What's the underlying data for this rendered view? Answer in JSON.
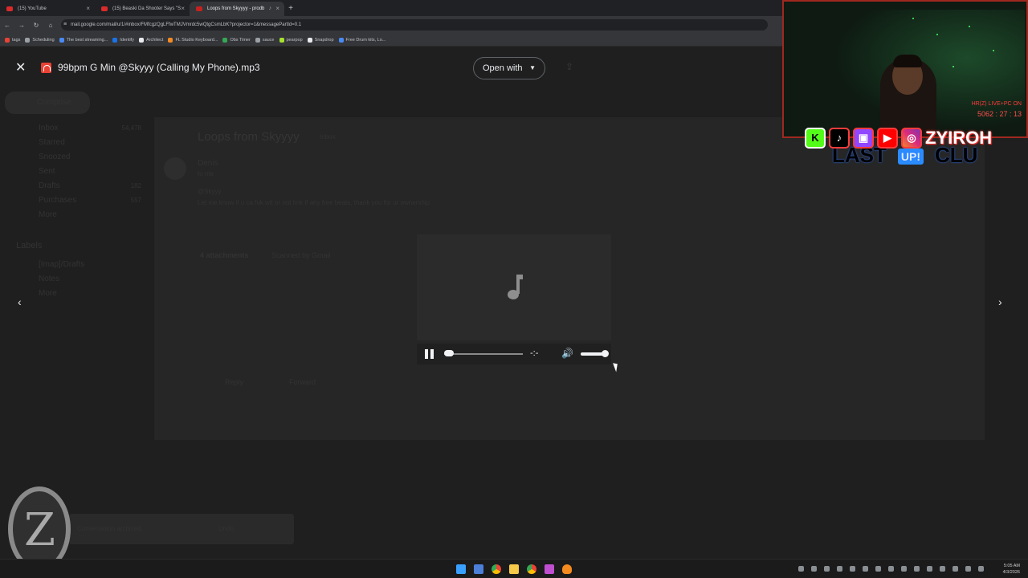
{
  "browser": {
    "tabs": [
      {
        "label": "(15) YouTube",
        "active": false
      },
      {
        "label": "(15) Beaski Da Shooter Says \"S",
        "active": false
      },
      {
        "label": "Loops from Skyyyy - prodb",
        "active": true
      }
    ],
    "url": "mail.google.com/mail/u/1/#inbox/FMfcgzQgLFfwTMJVmrdc5wQtgCsmLbK?projector=1&messagePartId=0.1",
    "bookmarks": [
      "tags",
      "Scheduling",
      "The best streaming...",
      "Identify",
      "Architect",
      "FL Studio Keyboard...",
      "Obs Timer",
      "sauce",
      "pearpop",
      "Snapdrop",
      "Free Drum kits, Lo..."
    ]
  },
  "viewer": {
    "file_name": "99bpm G Min @Skyyy (Calling My Phone).mp3",
    "open_with_label": "Open with"
  },
  "dimmed_mail": {
    "compose": "Compose",
    "nav": [
      {
        "label": "Inbox",
        "count": "54,478"
      },
      {
        "label": "Starred",
        "count": ""
      },
      {
        "label": "Snoozed",
        "count": ""
      },
      {
        "label": "Sent",
        "count": ""
      },
      {
        "label": "Drafts",
        "count": "182"
      },
      {
        "label": "Purchases",
        "count": "557"
      },
      {
        "label": "More",
        "count": ""
      }
    ],
    "labels_heading": "Labels",
    "labels": [
      "[Imap]/Drafts",
      "Notes",
      "More"
    ],
    "subject": "Loops from Skyyyy",
    "subject_tag": "Inbox",
    "sender": "Denis",
    "to": "to me",
    "greeting": "@Skyyy",
    "body": "Let me know if u ca fuk wit or not lmk if any free beats, thank you for ur ownership",
    "attachments_label": "4 attachments",
    "scanned_label": "Scanned by Gmail",
    "reply_label": "Reply",
    "forward_label": "Forward",
    "snackbar_text": "Conversation archived.",
    "snackbar_action": "Undo"
  },
  "player": {
    "state": "playing",
    "seek_fraction": 0.0,
    "volume_fraction": 1.0
  },
  "stream_overlay": {
    "stat_line": "HR(Z) LIVE+PC ON",
    "counter": "5062 : 27 : 13",
    "handle": "ZYIROH",
    "socials": [
      "K",
      "♪",
      "▣",
      "▶",
      "◎"
    ],
    "marquee_left": "LAST",
    "marquee_badge": "UP!",
    "marquee_right": "CLU"
  },
  "taskbar": {
    "time": "5:05 AM",
    "date": "4/3/2026"
  },
  "colors": {
    "accent_red": "#e94235",
    "overlay_red": "#ff3b3b",
    "background": "#1f1f1f"
  }
}
